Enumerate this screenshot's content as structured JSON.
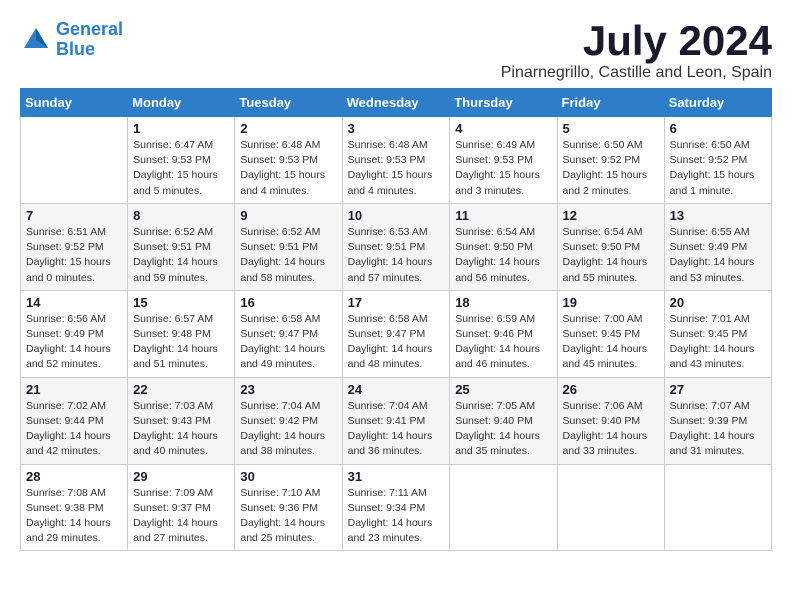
{
  "logo": {
    "line1": "General",
    "line2": "Blue"
  },
  "title": "July 2024",
  "location": "Pinarnegrillo, Castille and Leon, Spain",
  "days_of_week": [
    "Sunday",
    "Monday",
    "Tuesday",
    "Wednesday",
    "Thursday",
    "Friday",
    "Saturday"
  ],
  "weeks": [
    [
      {
        "num": "",
        "info": ""
      },
      {
        "num": "1",
        "info": "Sunrise: 6:47 AM\nSunset: 9:53 PM\nDaylight: 15 hours\nand 5 minutes."
      },
      {
        "num": "2",
        "info": "Sunrise: 6:48 AM\nSunset: 9:53 PM\nDaylight: 15 hours\nand 4 minutes."
      },
      {
        "num": "3",
        "info": "Sunrise: 6:48 AM\nSunset: 9:53 PM\nDaylight: 15 hours\nand 4 minutes."
      },
      {
        "num": "4",
        "info": "Sunrise: 6:49 AM\nSunset: 9:53 PM\nDaylight: 15 hours\nand 3 minutes."
      },
      {
        "num": "5",
        "info": "Sunrise: 6:50 AM\nSunset: 9:52 PM\nDaylight: 15 hours\nand 2 minutes."
      },
      {
        "num": "6",
        "info": "Sunrise: 6:50 AM\nSunset: 9:52 PM\nDaylight: 15 hours\nand 1 minute."
      }
    ],
    [
      {
        "num": "7",
        "info": "Sunrise: 6:51 AM\nSunset: 9:52 PM\nDaylight: 15 hours\nand 0 minutes."
      },
      {
        "num": "8",
        "info": "Sunrise: 6:52 AM\nSunset: 9:51 PM\nDaylight: 14 hours\nand 59 minutes."
      },
      {
        "num": "9",
        "info": "Sunrise: 6:52 AM\nSunset: 9:51 PM\nDaylight: 14 hours\nand 58 minutes."
      },
      {
        "num": "10",
        "info": "Sunrise: 6:53 AM\nSunset: 9:51 PM\nDaylight: 14 hours\nand 57 minutes."
      },
      {
        "num": "11",
        "info": "Sunrise: 6:54 AM\nSunset: 9:50 PM\nDaylight: 14 hours\nand 56 minutes."
      },
      {
        "num": "12",
        "info": "Sunrise: 6:54 AM\nSunset: 9:50 PM\nDaylight: 14 hours\nand 55 minutes."
      },
      {
        "num": "13",
        "info": "Sunrise: 6:55 AM\nSunset: 9:49 PM\nDaylight: 14 hours\nand 53 minutes."
      }
    ],
    [
      {
        "num": "14",
        "info": "Sunrise: 6:56 AM\nSunset: 9:49 PM\nDaylight: 14 hours\nand 52 minutes."
      },
      {
        "num": "15",
        "info": "Sunrise: 6:57 AM\nSunset: 9:48 PM\nDaylight: 14 hours\nand 51 minutes."
      },
      {
        "num": "16",
        "info": "Sunrise: 6:58 AM\nSunset: 9:47 PM\nDaylight: 14 hours\nand 49 minutes."
      },
      {
        "num": "17",
        "info": "Sunrise: 6:58 AM\nSunset: 9:47 PM\nDaylight: 14 hours\nand 48 minutes."
      },
      {
        "num": "18",
        "info": "Sunrise: 6:59 AM\nSunset: 9:46 PM\nDaylight: 14 hours\nand 46 minutes."
      },
      {
        "num": "19",
        "info": "Sunrise: 7:00 AM\nSunset: 9:45 PM\nDaylight: 14 hours\nand 45 minutes."
      },
      {
        "num": "20",
        "info": "Sunrise: 7:01 AM\nSunset: 9:45 PM\nDaylight: 14 hours\nand 43 minutes."
      }
    ],
    [
      {
        "num": "21",
        "info": "Sunrise: 7:02 AM\nSunset: 9:44 PM\nDaylight: 14 hours\nand 42 minutes."
      },
      {
        "num": "22",
        "info": "Sunrise: 7:03 AM\nSunset: 9:43 PM\nDaylight: 14 hours\nand 40 minutes."
      },
      {
        "num": "23",
        "info": "Sunrise: 7:04 AM\nSunset: 9:42 PM\nDaylight: 14 hours\nand 38 minutes."
      },
      {
        "num": "24",
        "info": "Sunrise: 7:04 AM\nSunset: 9:41 PM\nDaylight: 14 hours\nand 36 minutes."
      },
      {
        "num": "25",
        "info": "Sunrise: 7:05 AM\nSunset: 9:40 PM\nDaylight: 14 hours\nand 35 minutes."
      },
      {
        "num": "26",
        "info": "Sunrise: 7:06 AM\nSunset: 9:40 PM\nDaylight: 14 hours\nand 33 minutes."
      },
      {
        "num": "27",
        "info": "Sunrise: 7:07 AM\nSunset: 9:39 PM\nDaylight: 14 hours\nand 31 minutes."
      }
    ],
    [
      {
        "num": "28",
        "info": "Sunrise: 7:08 AM\nSunset: 9:38 PM\nDaylight: 14 hours\nand 29 minutes."
      },
      {
        "num": "29",
        "info": "Sunrise: 7:09 AM\nSunset: 9:37 PM\nDaylight: 14 hours\nand 27 minutes."
      },
      {
        "num": "30",
        "info": "Sunrise: 7:10 AM\nSunset: 9:36 PM\nDaylight: 14 hours\nand 25 minutes."
      },
      {
        "num": "31",
        "info": "Sunrise: 7:11 AM\nSunset: 9:34 PM\nDaylight: 14 hours\nand 23 minutes."
      },
      {
        "num": "",
        "info": ""
      },
      {
        "num": "",
        "info": ""
      },
      {
        "num": "",
        "info": ""
      }
    ]
  ]
}
